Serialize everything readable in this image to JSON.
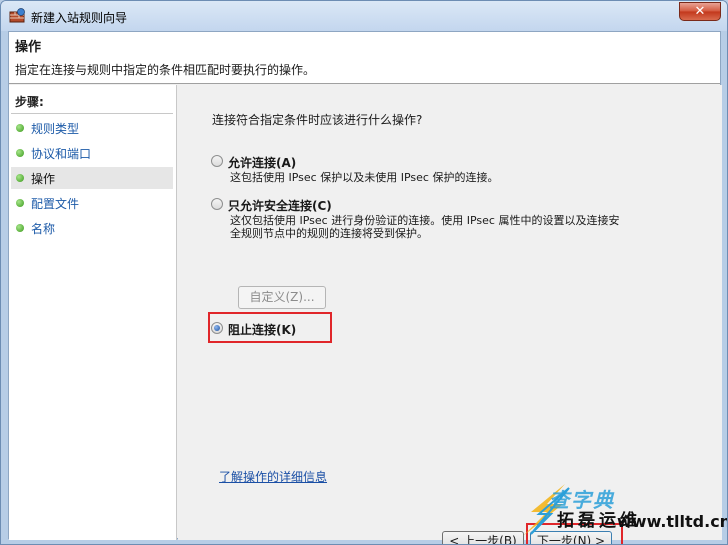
{
  "window": {
    "title": "新建入站规则向导",
    "close_label": "✕"
  },
  "header": {
    "title": "操作",
    "description": "指定在连接与规则中指定的条件相匹配时要执行的操作。"
  },
  "sidebar": {
    "steps_label": "步骤:",
    "items": [
      {
        "label": "规则类型",
        "active": false
      },
      {
        "label": "协议和端口",
        "active": false
      },
      {
        "label": "操作",
        "active": true
      },
      {
        "label": "配置文件",
        "active": false
      },
      {
        "label": "名称",
        "active": false
      }
    ]
  },
  "content": {
    "question": "连接符合指定条件时应该进行什么操作?",
    "options": [
      {
        "label": "允许连接(A)",
        "desc": "这包括使用 IPsec 保护以及未使用 IPsec 保护的连接。",
        "checked": false
      },
      {
        "label": "只允许安全连接(C)",
        "desc_line1": "这仅包括使用 IPsec 进行身份验证的连接。使用 IPsec 属性中的设置以及连接安",
        "desc_line2": "全规则节点中的规则的连接将受到保护。",
        "checked": false
      },
      {
        "label": "阻止连接(K)",
        "checked": true
      }
    ],
    "customize_label": "自定义(Z)...",
    "help_link": "了解操作的详细信息"
  },
  "nav": {
    "prev_label": "< 上一步(B)",
    "next_label": "下一步(N) >"
  },
  "watermark": {
    "line1": "查字典",
    "line2": "拓磊运维",
    "url": "www.tlltd.cn"
  },
  "colors": {
    "link": "#1a4fa5",
    "highlight": "#e0262a",
    "step_dot": "#3b9a1c"
  }
}
